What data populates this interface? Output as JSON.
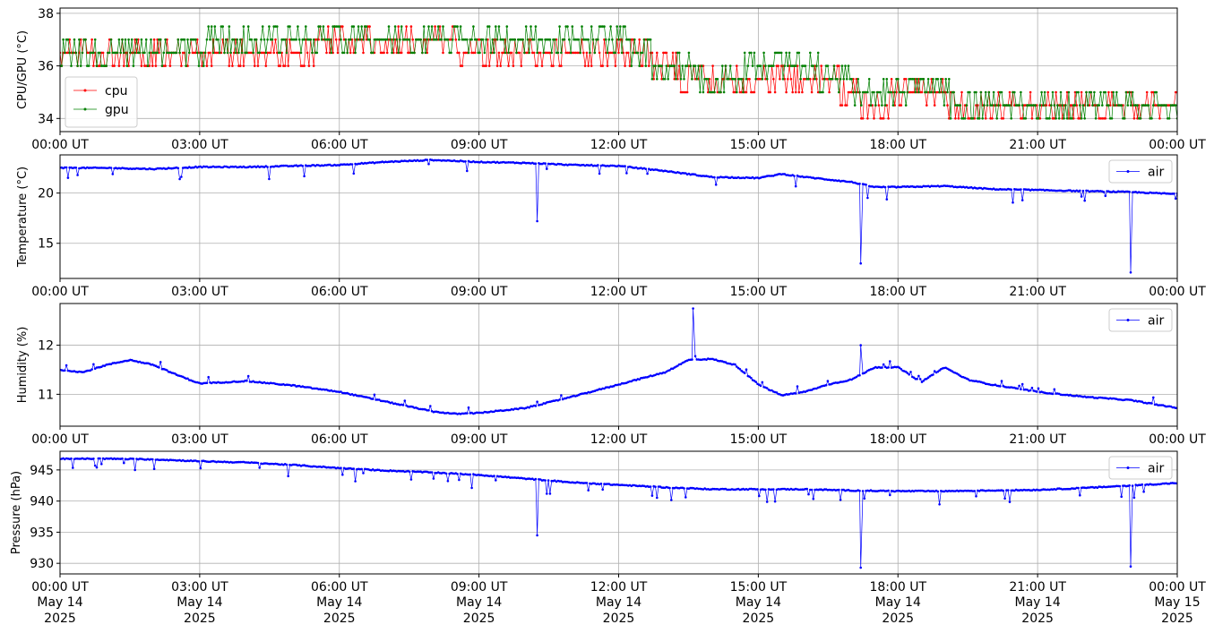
{
  "chart_data": [
    {
      "type": "line",
      "ylabel": "CPU/GPU (°C)",
      "x_ticks": [
        "00:00 UT",
        "03:00 UT",
        "06:00 UT",
        "09:00 UT",
        "12:00 UT",
        "15:00 UT",
        "18:00 UT",
        "21:00 UT",
        "00:00 UT"
      ],
      "x_tick_hours": [
        0,
        3,
        6,
        9,
        12,
        15,
        18,
        21,
        24
      ],
      "xlim": [
        0,
        24
      ],
      "ylim": [
        33.5,
        38.2
      ],
      "y_ticks": [
        34,
        36,
        38
      ],
      "grid": true,
      "legend": "lower-left",
      "series": [
        {
          "name": "cpu",
          "color": "#ff0000",
          "x": [
            0,
            0.3,
            1,
            2,
            3,
            4,
            5,
            5.4,
            5.6,
            6,
            7,
            8,
            9,
            10,
            11,
            12,
            12.5,
            13,
            13.5,
            14,
            15,
            16,
            17,
            17.2,
            18,
            19,
            19.3,
            20,
            21,
            22,
            23,
            24
          ],
          "values": [
            36.5,
            36.5,
            36.5,
            36.5,
            36.5,
            36.5,
            36.5,
            36.5,
            36.8,
            37.0,
            37.0,
            37.0,
            36.5,
            36.5,
            36.5,
            36.5,
            36.5,
            35.9,
            35.6,
            35.4,
            35.4,
            35.4,
            35.2,
            34.6,
            34.8,
            34.8,
            34.5,
            34.4,
            34.3,
            34.3,
            34.3,
            34.3
          ]
        },
        {
          "name": "gpu",
          "color": "#008000",
          "x": [
            0,
            0.3,
            1,
            2,
            3,
            4,
            5,
            6,
            7,
            8,
            9,
            10,
            11,
            12,
            12.5,
            13,
            13.5,
            14,
            15,
            16,
            17,
            17.2,
            18,
            19,
            20,
            21,
            22,
            23,
            24
          ],
          "values": [
            36.5,
            36.5,
            36.5,
            36.5,
            36.7,
            37.0,
            37.0,
            37.0,
            37.2,
            37.2,
            37.0,
            37.0,
            37.0,
            37.0,
            36.5,
            35.9,
            35.9,
            35.4,
            35.9,
            35.9,
            35.4,
            34.8,
            34.8,
            34.8,
            34.3,
            34.3,
            34.3,
            34.3,
            34.3
          ]
        }
      ]
    },
    {
      "type": "line",
      "ylabel": "Temperature (°C)",
      "x_ticks": [
        "00:00 UT",
        "03:00 UT",
        "06:00 UT",
        "09:00 UT",
        "12:00 UT",
        "15:00 UT",
        "18:00 UT",
        "21:00 UT",
        "00:00 UT"
      ],
      "x_tick_hours": [
        0,
        3,
        6,
        9,
        12,
        15,
        18,
        21,
        24
      ],
      "xlim": [
        0,
        24
      ],
      "ylim": [
        11.5,
        23.8
      ],
      "y_ticks": [
        15,
        20
      ],
      "grid": true,
      "legend": "top-right",
      "series": [
        {
          "name": "air",
          "color": "#0000ff",
          "x": [
            0,
            1,
            2,
            3,
            4,
            5,
            6,
            7,
            8,
            8.5,
            9,
            10,
            11,
            12,
            13,
            14,
            15,
            15.5,
            16,
            17,
            17.5,
            18,
            19,
            20,
            21,
            22,
            23,
            24
          ],
          "values": [
            22.5,
            22.5,
            22.4,
            22.6,
            22.6,
            22.7,
            22.8,
            23.1,
            23.3,
            23.2,
            23.1,
            23.0,
            22.8,
            22.7,
            22.2,
            21.6,
            21.5,
            21.9,
            21.6,
            21.1,
            20.6,
            20.6,
            20.7,
            20.4,
            20.3,
            20.2,
            20.1,
            19.9
          ]
        }
      ],
      "outliers": [
        {
          "x": 10.25,
          "y": 17.2
        },
        {
          "x": 17.2,
          "y": 13.0
        },
        {
          "x": 23.0,
          "y": 12.1
        }
      ]
    },
    {
      "type": "line",
      "ylabel": "Humidity (%)",
      "x_ticks": [
        "00:00 UT",
        "03:00 UT",
        "06:00 UT",
        "09:00 UT",
        "12:00 UT",
        "15:00 UT",
        "18:00 UT",
        "21:00 UT",
        "00:00 UT"
      ],
      "x_tick_hours": [
        0,
        3,
        6,
        9,
        12,
        15,
        18,
        21,
        24
      ],
      "xlim": [
        0,
        24
      ],
      "ylim": [
        10.35,
        12.85
      ],
      "y_ticks": [
        11,
        12
      ],
      "grid": true,
      "legend": "top-right",
      "series": [
        {
          "name": "air",
          "color": "#0000ff",
          "x": [
            0,
            0.5,
            1,
            1.5,
            2,
            2.5,
            3,
            4,
            5,
            6,
            6.5,
            7,
            8,
            8.5,
            9,
            10,
            11,
            12,
            13,
            13.5,
            14,
            14.5,
            15,
            15.5,
            16,
            16.5,
            17,
            17.5,
            18,
            18.5,
            19,
            19.5,
            20,
            21,
            22,
            23,
            24
          ],
          "values": [
            11.5,
            11.45,
            11.6,
            11.7,
            11.6,
            11.4,
            11.22,
            11.27,
            11.18,
            11.05,
            10.95,
            10.85,
            10.65,
            10.6,
            10.62,
            10.72,
            10.95,
            11.2,
            11.45,
            11.7,
            11.72,
            11.6,
            11.2,
            10.98,
            11.05,
            11.2,
            11.3,
            11.55,
            11.55,
            11.25,
            11.55,
            11.3,
            11.2,
            11.05,
            10.95,
            10.88,
            10.72
          ]
        }
      ],
      "outliers": [
        {
          "x": 13.6,
          "y": 12.75
        },
        {
          "x": 17.2,
          "y": 12.0
        }
      ]
    },
    {
      "type": "line",
      "ylabel": "Pressure (hPa)",
      "x_ticks": [
        "00:00 UT",
        "03:00 UT",
        "06:00 UT",
        "09:00 UT",
        "12:00 UT",
        "15:00 UT",
        "18:00 UT",
        "21:00 UT",
        "00:00 UT"
      ],
      "x_dates": [
        "May 14",
        "May 14",
        "May 14",
        "May 14",
        "May 14",
        "May 14",
        "May 14",
        "May 14",
        "May 15"
      ],
      "x_years": [
        "2025",
        "2025",
        "2025",
        "2025",
        "2025",
        "2025",
        "2025",
        "2025",
        "2025"
      ],
      "x_tick_hours": [
        0,
        3,
        6,
        9,
        12,
        15,
        18,
        21,
        24
      ],
      "xlim": [
        0,
        24
      ],
      "ylim": [
        928.3,
        948.0
      ],
      "y_ticks": [
        930,
        935,
        940,
        945
      ],
      "grid": true,
      "legend": "top-right",
      "series": [
        {
          "name": "air",
          "color": "#0000ff",
          "x": [
            0,
            1,
            2,
            3,
            4,
            5,
            6,
            7,
            8,
            9,
            10,
            11,
            12,
            13,
            14,
            15,
            16,
            17,
            18,
            19,
            20,
            21,
            22,
            23,
            24
          ],
          "values": [
            946.8,
            946.8,
            946.7,
            946.4,
            946.2,
            945.8,
            945.3,
            944.9,
            944.6,
            944.2,
            943.6,
            943.0,
            942.6,
            942.2,
            941.9,
            941.9,
            941.9,
            941.7,
            941.6,
            941.6,
            941.7,
            941.8,
            942.1,
            942.5,
            942.9
          ]
        }
      ],
      "outliers": [
        {
          "x": 10.25,
          "y": 934.5
        },
        {
          "x": 17.2,
          "y": 929.3
        },
        {
          "x": 23.0,
          "y": 929.5
        }
      ]
    }
  ]
}
